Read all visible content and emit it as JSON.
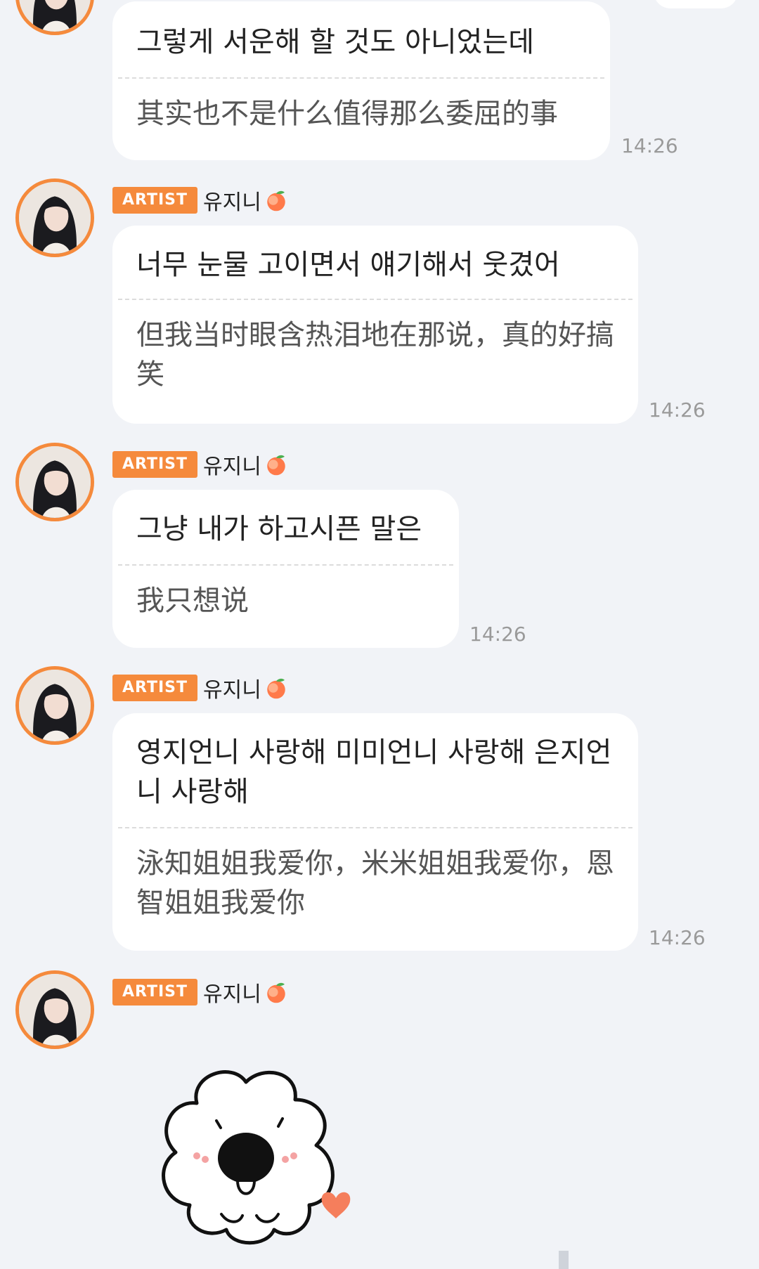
{
  "messages": [
    {
      "ko": "그렇게 서운해 할 것도 아니었는데",
      "zh": "其实也不是什么值得那么委屈的事",
      "time": "14:26"
    },
    {
      "badge": "ARTIST",
      "name": "유지니",
      "ko": "너무 눈물 고이면서 얘기해서 웃겼어",
      "zh": "但我当时眼含热泪地在那说，真的好搞笑",
      "time": "14:26"
    },
    {
      "badge": "ARTIST",
      "name": "유지니",
      "ko": "그냥 내가 하고시픈 말은",
      "zh": "我只想说",
      "time": "14:26"
    },
    {
      "badge": "ARTIST",
      "name": "유지니",
      "ko": "영지언니 사랑해 미미언니 사랑해 은지언니 사랑해",
      "zh": "泳知姐姐我爱你，米米姐姐我爱你，恩智姐姐我爱你",
      "time": "14:26"
    },
    {
      "badge": "ARTIST",
      "name": "유지니",
      "sticker": "white-puppy-sticker"
    }
  ],
  "colors": {
    "accent": "#f58a3c",
    "background": "#f1f3f7",
    "bubble": "#ffffff",
    "time": "#9a9a9a"
  },
  "icons": {
    "name_suffix": "peach-icon"
  }
}
